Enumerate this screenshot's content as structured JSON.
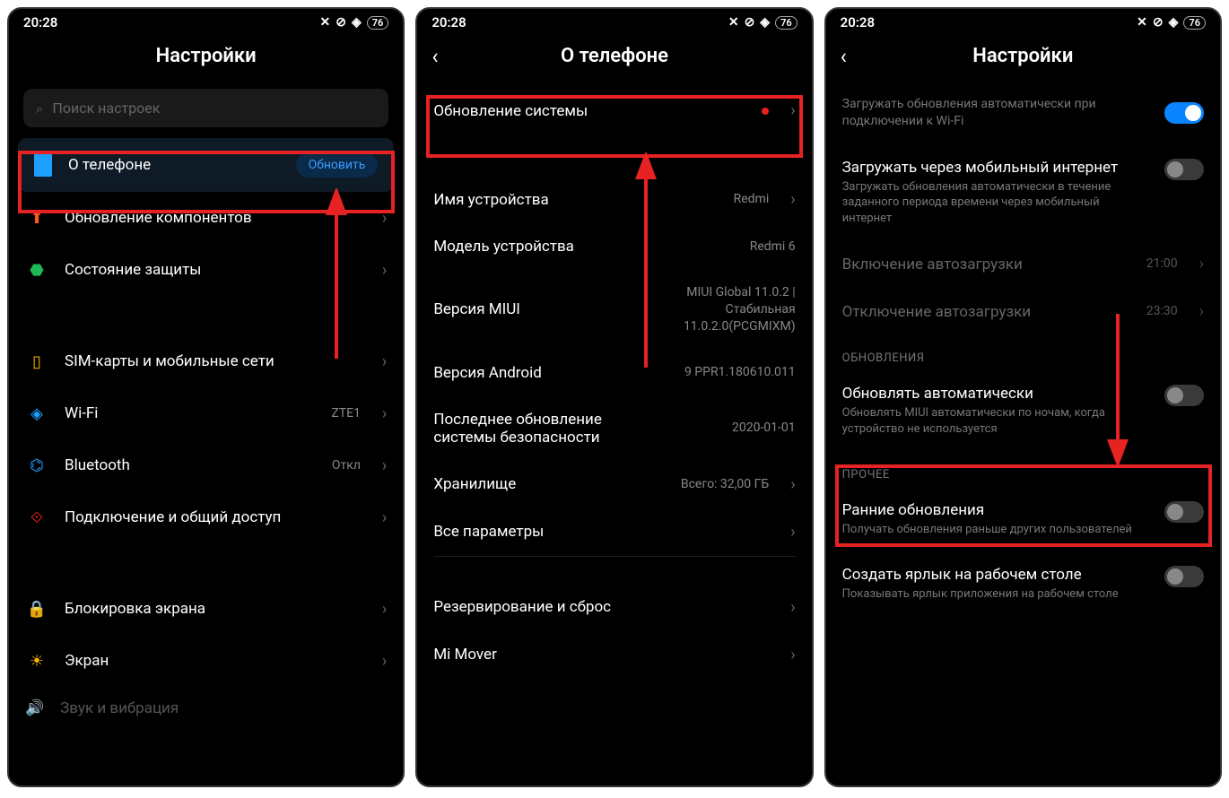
{
  "status": {
    "time": "20:28",
    "battery": "76"
  },
  "screen1": {
    "title": "Настройки",
    "search_placeholder": "Поиск настроек",
    "about_phone": "О телефоне",
    "update_pill": "Обновить",
    "components_update": "Обновление компонентов",
    "security_status": "Состояние защиты",
    "sim": "SIM-карты и мобильные сети",
    "wifi": "Wi-Fi",
    "wifi_value": "ZTE1",
    "bluetooth": "Bluetooth",
    "bluetooth_value": "Откл",
    "connection_share": "Подключение и общий доступ",
    "lock_screen": "Блокировка экрана",
    "display": "Экран",
    "sound_cut": "Звук и вибрация"
  },
  "screen2": {
    "title": "О телефоне",
    "system_update": "Обновление системы",
    "device_name": "Имя устройства",
    "device_name_value": "Redmi",
    "model": "Модель устройства",
    "model_value": "Redmi 6",
    "miui": "Версия MIUI",
    "miui_value": "MIUI Global 11.0.2 | Стабильная 11.0.2.0(PCGMIXM)",
    "android": "Версия Android",
    "android_value": "9 PPR1.180610.011",
    "security_patch": "Последнее обновление системы безопасности",
    "security_patch_value": "2020-01-01",
    "storage": "Хранилище",
    "storage_value": "Всего: 32,00 ГБ",
    "all_params": "Все параметры",
    "backup": "Резервирование и сброс",
    "mimover": "Mi Mover"
  },
  "screen3": {
    "title": "Настройки",
    "wifi_auto": "Загружать обновления автоматически при подключении к Wi-Fi",
    "mobile_title": "Загружать через мобильный интернет",
    "mobile_sub": "Загружать обновления автоматически в течение заданного периода времени через мобильный интернет",
    "auto_on": "Включение автозагрузки",
    "auto_on_value": "21:00",
    "auto_off": "Отключение автозагрузки",
    "auto_off_value": "23:30",
    "section_updates": "ОБНОВЛЕНИЯ",
    "auto_update": "Обновлять автоматически",
    "auto_update_sub": "Обновлять MIUI автоматически по ночам, когда устройство не используется",
    "section_other": "ПРОЧЕЕ",
    "early": "Ранние обновления",
    "early_sub": "Получать обновления раньше других пользователей",
    "shortcut": "Создать ярлык на рабочем столе",
    "shortcut_sub": "Показывать ярлык приложения на рабочем столе"
  }
}
